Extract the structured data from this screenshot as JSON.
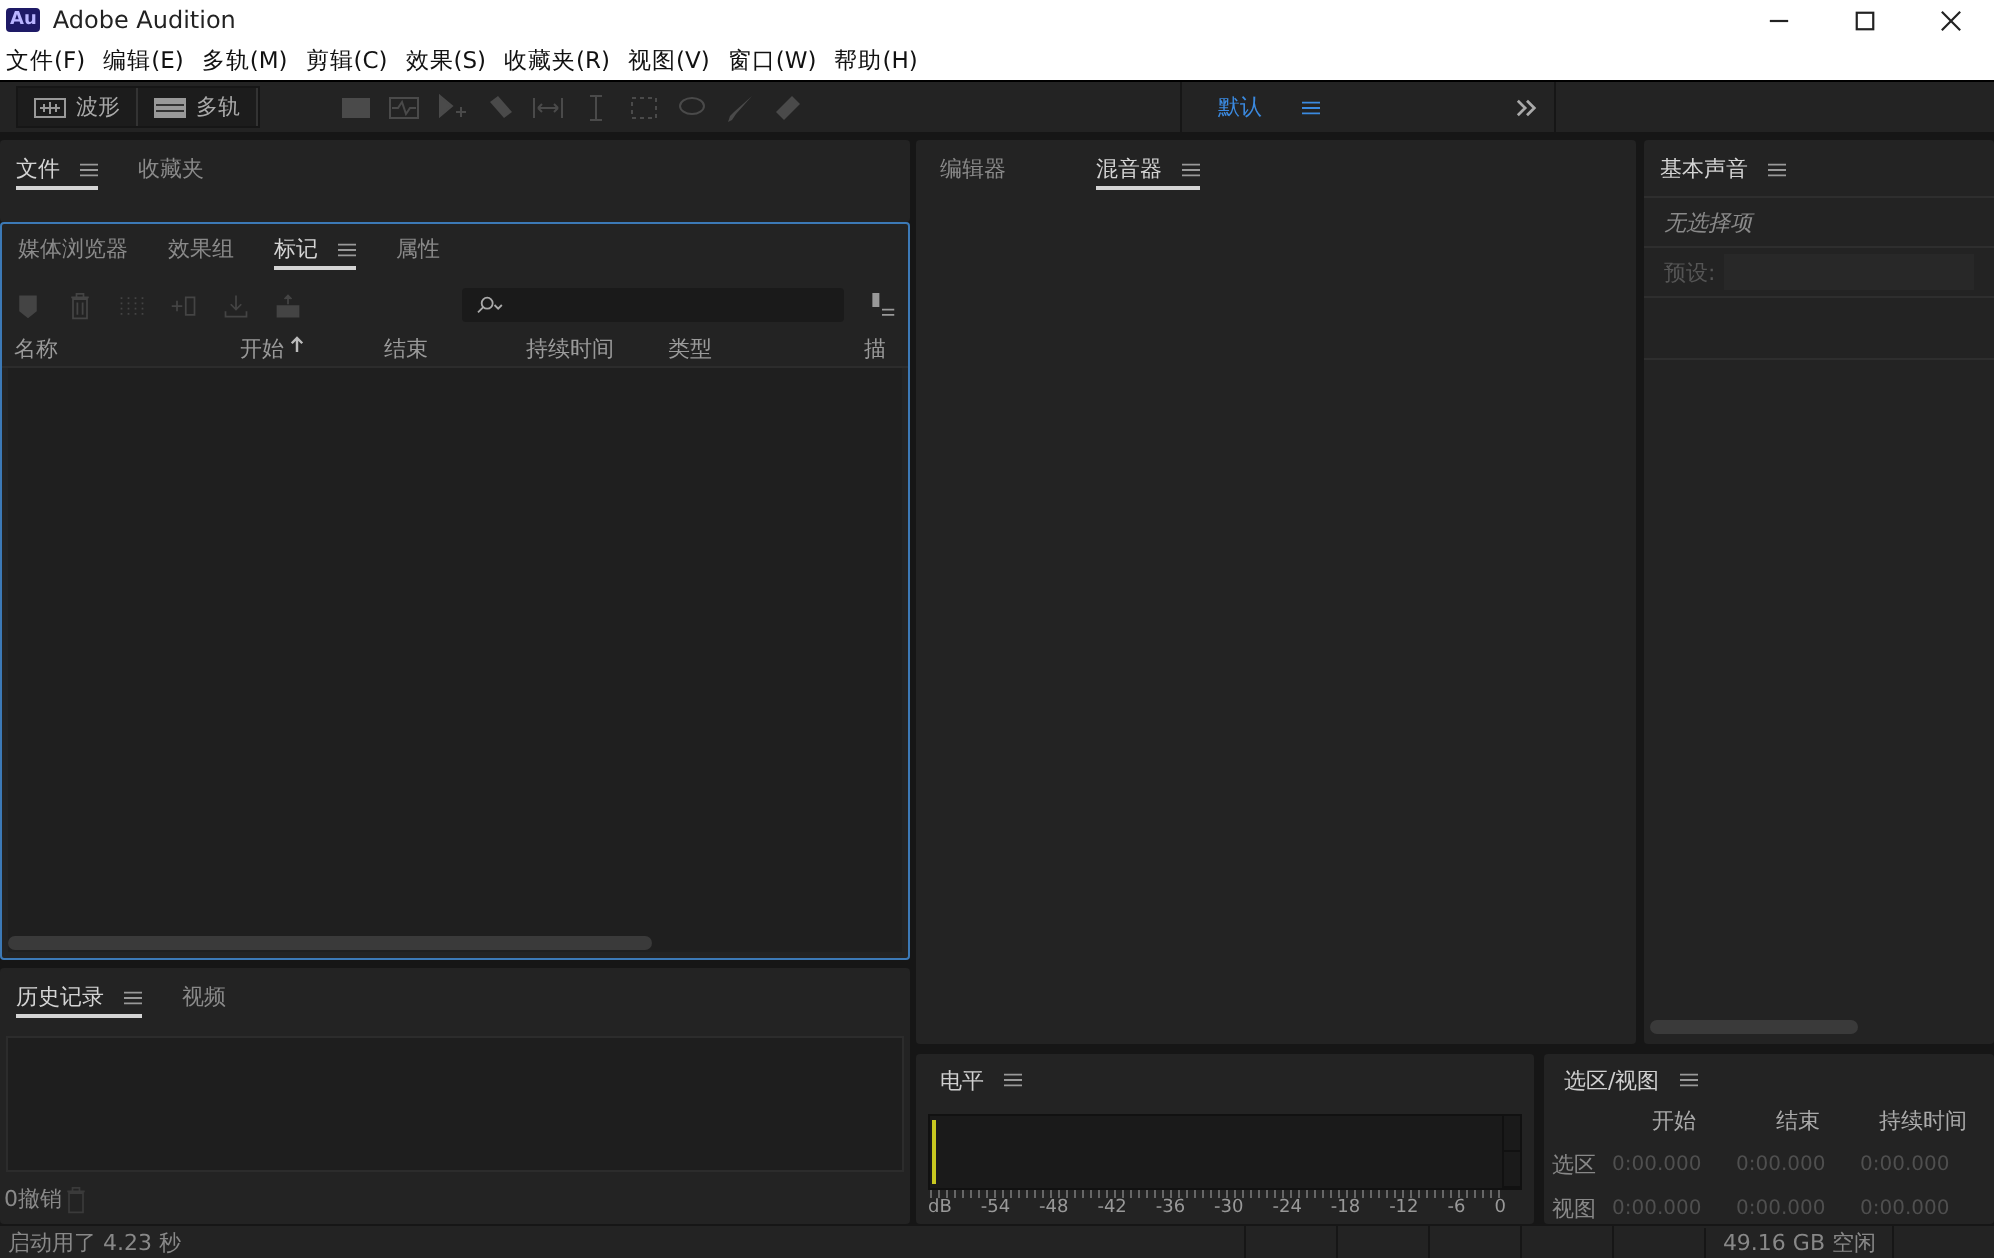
{
  "window": {
    "title": "Adobe Audition",
    "app_icon": "Au"
  },
  "menu": [
    "文件(F)",
    "编辑(E)",
    "多轨(M)",
    "剪辑(C)",
    "效果(S)",
    "收藏夹(R)",
    "视图(V)",
    "窗口(W)",
    "帮助(H)"
  ],
  "toolbar": {
    "modes": [
      {
        "label": "波形",
        "kind": "waveform"
      },
      {
        "label": "多轨",
        "kind": "multitrack"
      }
    ],
    "workspace": "默认"
  },
  "files_panel": {
    "tabs": [
      {
        "label": "文件",
        "selected": true
      },
      {
        "label": "收藏夹",
        "selected": false
      }
    ]
  },
  "markers_panel": {
    "tabs": [
      {
        "label": "媒体浏览器",
        "selected": false
      },
      {
        "label": "效果组",
        "selected": false
      },
      {
        "label": "标记",
        "selected": true
      },
      {
        "label": "属性",
        "selected": false
      }
    ],
    "columns": [
      {
        "label": "名称",
        "sorted": false
      },
      {
        "label": "开始",
        "sorted": true
      },
      {
        "label": "结束",
        "sorted": false
      },
      {
        "label": "持续时间",
        "sorted": false
      },
      {
        "label": "类型",
        "sorted": false
      },
      {
        "label": "描",
        "sorted": false
      }
    ]
  },
  "history_panel": {
    "tabs": [
      {
        "label": "历史记录",
        "selected": true
      },
      {
        "label": "视频",
        "selected": false
      }
    ],
    "undo_count": "0撤销"
  },
  "mixer_panel": {
    "tabs": [
      {
        "label": "编辑器",
        "selected": false
      },
      {
        "label": "混音器",
        "selected": true
      }
    ]
  },
  "essential_sound_panel": {
    "title": "基本声音",
    "status": "无选择项",
    "preset_label": "预设:"
  },
  "levels_panel": {
    "title": "电平",
    "scale": [
      "dB",
      "-54",
      "-48",
      "-42",
      "-36",
      "-30",
      "-24",
      "-18",
      "-12",
      "-6",
      "0"
    ]
  },
  "selection_panel": {
    "title": "选区/视图",
    "columns": [
      "开始",
      "结束",
      "持续时间"
    ],
    "rows": [
      {
        "label": "选区",
        "values": [
          "0:00.000",
          "0:00.000",
          "0:00.000"
        ]
      },
      {
        "label": "视图",
        "values": [
          "0:00.000",
          "0:00.000",
          "0:00.000"
        ]
      }
    ]
  },
  "status_bar": {
    "message": "启动用了 4.23 秒",
    "free_space": "49.16 GB 空闲"
  }
}
